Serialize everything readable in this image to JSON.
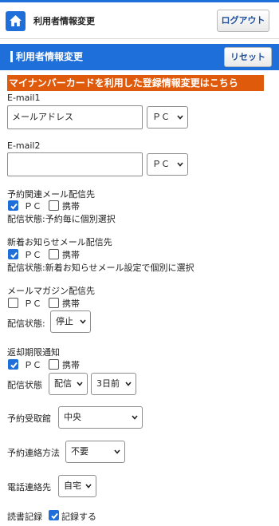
{
  "header": {
    "title": "利用者情報変更",
    "logout_label": "ログアウト"
  },
  "band": {
    "title": "利用者情報変更",
    "reset_label": "リセット"
  },
  "mynumber_link": "マイナンバーカードを利用した登録情報変更はこちら",
  "email1": {
    "label": "E-mail1",
    "value": "メールアドレス",
    "device": "ＰＣ"
  },
  "email2": {
    "label": "E-mail2",
    "value": "",
    "device": "ＰＣ"
  },
  "reservation_mail": {
    "label": "予約関連メール配信先",
    "pc_label": "ＰＣ",
    "mobile_label": "携帯",
    "pc_checked": true,
    "mobile_checked": false,
    "status": "配信状態:予約毎に個別選択"
  },
  "new_arrival_mail": {
    "label": "新着お知らせメール配信先",
    "pc_label": "ＰＣ",
    "mobile_label": "携帯",
    "pc_checked": true,
    "mobile_checked": false,
    "status": "配信状態:新着お知らせメール設定で個別に選択"
  },
  "magazine_mail": {
    "label": "メールマガジン配信先",
    "pc_label": "ＰＣ",
    "mobile_label": "携帯",
    "pc_checked": false,
    "mobile_checked": false,
    "status_label": "配信状態:",
    "status_value": "停止"
  },
  "return_notice": {
    "label": "返却期限通知",
    "pc_label": "ＰＣ",
    "mobile_label": "携帯",
    "pc_checked": true,
    "mobile_checked": false,
    "status_label": "配信状態",
    "status_value": "配信",
    "timing_value": "3日前"
  },
  "pickup_library": {
    "label": "予約受取館",
    "value": "中央"
  },
  "contact_method": {
    "label": "予約連絡方法",
    "value": "不要"
  },
  "phone_contact": {
    "label": "電話連絡先",
    "value": "自宅"
  },
  "reading_record": {
    "label": "読書記録",
    "checkbox_label": "記録する",
    "checked": true
  },
  "colors": {
    "accent": "#1e6fd9",
    "mynumber_banner": "#e05a0b"
  }
}
